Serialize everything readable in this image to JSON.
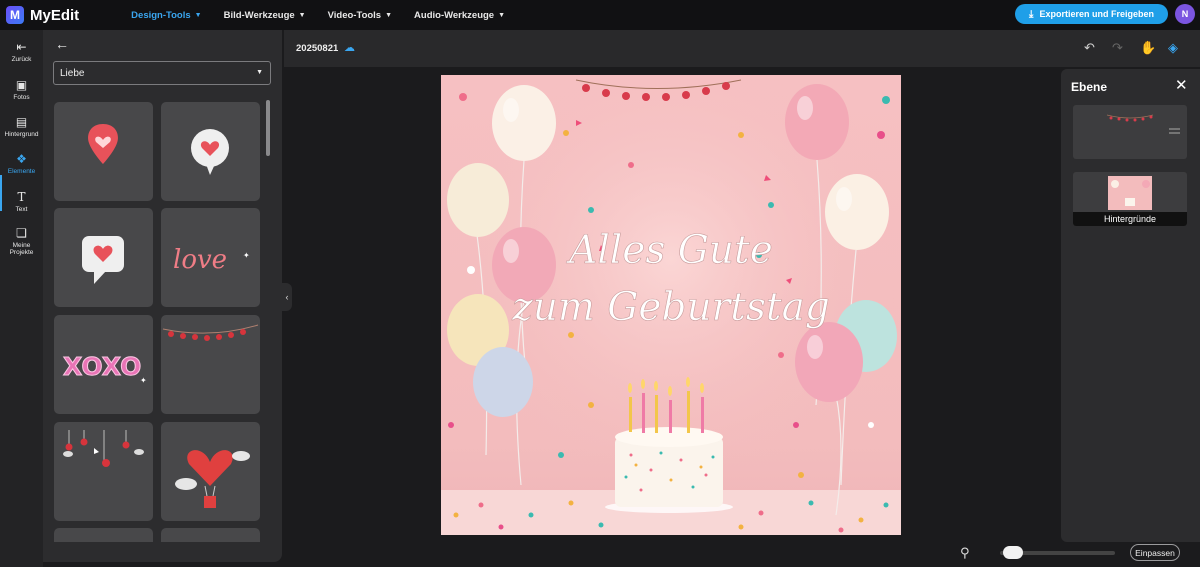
{
  "app": {
    "name": "MyEdit",
    "logo_letter": "M"
  },
  "nav": [
    {
      "label": "Design-Tools",
      "active": true
    },
    {
      "label": "Bild-Werkzeuge",
      "active": false
    },
    {
      "label": "Video-Tools",
      "active": false
    },
    {
      "label": "Audio-Werkzeuge",
      "active": false
    }
  ],
  "export_label": "Exportieren und Freigeben",
  "user_initial": "N",
  "rail": {
    "back": "Zurück",
    "photos": "Fotos",
    "background": "Hintergrund",
    "elements": "Elemente",
    "text": "Text",
    "projects_line1": "Meine",
    "projects_line2": "Projekte"
  },
  "panel": {
    "category": "Liebe"
  },
  "canvas": {
    "project_name": "20250821",
    "headline_line1": "Alles Gute",
    "headline_line2": "zum Geburtstag"
  },
  "layers": {
    "title": "Ebene",
    "background_label": "Hintergründe"
  },
  "zoom": {
    "fit_label": "Einpassen",
    "level": 0.1
  },
  "colors": {
    "accent": "#3aa6f0",
    "export": "#1f9fe8",
    "avatar": "#7b55e0"
  },
  "tiles": [
    {
      "icon": "heart-pin-icon"
    },
    {
      "icon": "heart-bubble-icon"
    },
    {
      "icon": "heart-speech-icon"
    },
    {
      "icon": "love-script-sticker",
      "text": "love"
    },
    {
      "icon": "xoxo-sticker",
      "text": "XOXO"
    },
    {
      "icon": "heart-garland-sticker"
    },
    {
      "icon": "hanging-hearts-sticker"
    },
    {
      "icon": "heart-balloon-sticker"
    }
  ]
}
